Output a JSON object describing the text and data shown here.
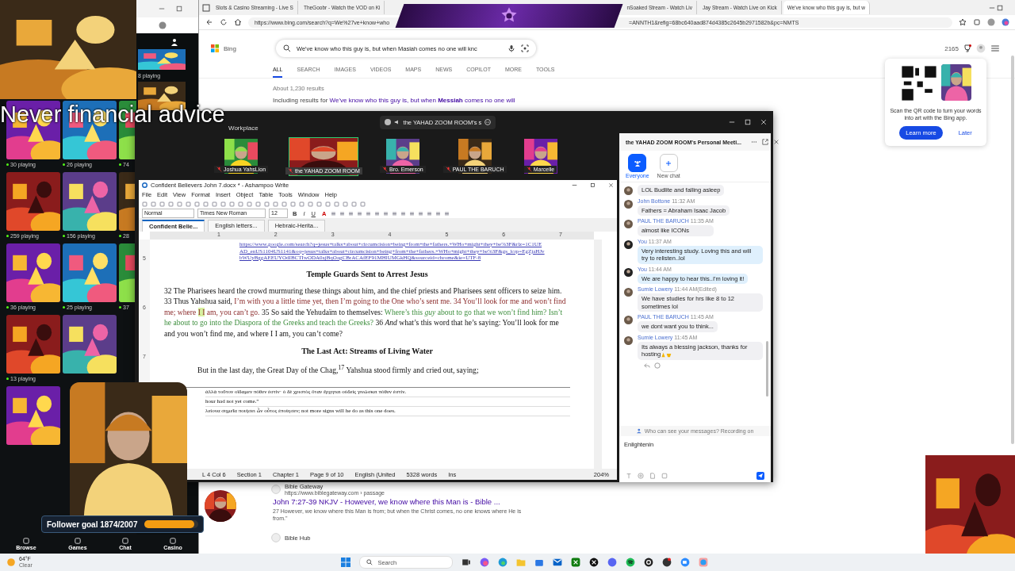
{
  "browser": {
    "tabs": [
      {
        "label": "Slots & Casino Streaming - Live S",
        "selected": false
      },
      {
        "label": "TheGoobr - Watch the VOD on Ki",
        "selected": false
      },
      {
        "label": "nSoaked Stream - Watch Liv",
        "selected": false
      },
      {
        "label": "Jay Stream - Watch Live on Kick",
        "selected": false
      },
      {
        "label": "We've know who this guy is, but w",
        "selected": true
      }
    ],
    "address_start": "https://www.bing.com/search?q=We%27ve+know+who",
    "address_end": "=ANNTH1&refig=68bc640aad874d4385c2645b2971582b&pc=NMTS"
  },
  "bing": {
    "logo_text": "Bing",
    "search_value": "We've know who this guy is, but when Masiah comes no one will knc",
    "points": "2165",
    "tabs": [
      {
        "label": "ALL",
        "selected": true
      },
      {
        "label": "SEARCH",
        "selected": false
      },
      {
        "label": "IMAGES",
        "selected": false
      },
      {
        "label": "VIDEOS",
        "selected": false
      },
      {
        "label": "MAPS",
        "selected": false
      },
      {
        "label": "NEWS",
        "selected": false
      },
      {
        "label": "COPILOT",
        "selected": false
      },
      {
        "label": "MORE",
        "selected": false
      },
      {
        "label": "TOOLS",
        "selected": false
      }
    ],
    "result_count": "About 1,230 results",
    "including_prefix": "Including results for",
    "including_link": "We've know who this guy is, but when **Messiah** comes no one will",
    "qr_card": {
      "text": "Scan the QR code to turn your words into art with the Bing app.",
      "learn": "Learn more",
      "later": "Later"
    },
    "results": [
      {
        "site": "Bible Gateway",
        "url": "https://www.biblegateway.com › passage",
        "title": "John 7:27-39 NKJV - However, we know where this Man is - Bible ...",
        "snippet": "27 However, we know where this Man is from; but when the Christ comes, no one knows where He is from.\""
      },
      {
        "site": "Bible Hub"
      }
    ]
  },
  "kick_sidebar": {
    "playing": "8 playing"
  },
  "casino": {
    "rows": [
      {
        "tiles": [
          {
            "kind": "game",
            "count": "30 playing"
          },
          {
            "kind": "game",
            "count": "26 playing"
          },
          {
            "kind": "game",
            "count": "74"
          }
        ]
      },
      {
        "tiles": [
          {
            "kind": "game",
            "count": "259 playing"
          },
          {
            "kind": "game",
            "count": "156 playing"
          },
          {
            "kind": "game",
            "count": "28"
          }
        ]
      },
      {
        "tiles": [
          {
            "kind": "game",
            "count": "36 playing"
          },
          {
            "kind": "game",
            "count": "25 playing"
          },
          {
            "kind": "game",
            "count": "37"
          }
        ]
      },
      {
        "tiles": [
          {
            "kind": "game",
            "count": "13 playing"
          },
          {
            "kind": "game"
          }
        ]
      },
      {
        "tiles": [
          {
            "kind": "game"
          }
        ]
      }
    ],
    "nav": [
      "Browse",
      "Games",
      "Chat",
      "Casino"
    ]
  },
  "overlay_text": "Never financial advice",
  "follower_goal": {
    "label": "Follower goal 1874/2007",
    "level": 0.93
  },
  "zoom": {
    "workplace": "Workplace",
    "speaker": "the YAHAD ZOOM ROOM's s",
    "participants": [
      {
        "name": "Joshua YahsLion",
        "selected": false
      },
      {
        "name": "the YAHAD ZOOM ROOM",
        "selected": true
      },
      {
        "name": "Bro. Emerson",
        "selected": false
      },
      {
        "name": "PAUL THE BARUCH",
        "selected": false
      },
      {
        "name": "Marcelle",
        "selected": false
      }
    ],
    "chat": {
      "title": "the YAHAD ZOOM ROOM's Personal Meeti...",
      "tabs": [
        {
          "label": "Everyone",
          "selected": true
        },
        {
          "label": "New chat",
          "selected": false
        }
      ],
      "messages": [
        {
          "text": "LOL Budlite and falling asleep",
          "mine": false
        },
        {
          "sender": "John Bottone",
          "time": "11:32 AM",
          "text": "Fathers = Abraham Isaac Jacob",
          "mine": false
        },
        {
          "sender": "PAUL THE BARUCH",
          "time": "11:35 AM",
          "text": "almost like ICONs",
          "mine": false
        },
        {
          "sender": "You",
          "time": "11:37 AM",
          "text": "Very interesting study. Loving this and will try to relisten..lol",
          "mine": true
        },
        {
          "sender": "You",
          "time": "11:44 AM",
          "text": "We are happy to hear this..I'm loving it!",
          "mine": true
        },
        {
          "sender": "Sumie Lowery",
          "time": "11:44 AM",
          "edited": "(Edited)",
          "text": "We have studies for hrs like 8 to 12 sometimes lol",
          "mine": false
        },
        {
          "sender": "PAUL THE BARUCH",
          "time": "11:45 AM",
          "text": "we dont want you to think...",
          "mine": false
        },
        {
          "sender": "Sumie Lowery",
          "time": "11:45 AM",
          "text": "Its always a blessing jackson, thanks for hosting",
          "emoji": true,
          "mine": false
        }
      ],
      "notice": "Who can see your messages? Recording on",
      "input_value": "Enlightenin"
    }
  },
  "writer": {
    "title": "Confident Believers John 7.docx * - Ashampoo Write",
    "menu": [
      "File",
      "Edit",
      "View",
      "Format",
      "Insert",
      "Object",
      "Table",
      "Tools",
      "Window",
      "Help"
    ],
    "style": "Normal",
    "font": "Times New Roman",
    "size": "12",
    "format_buttons": [
      "B",
      "I",
      "U",
      "A"
    ],
    "doc_tabs": [
      {
        "label": "Confident Belie...",
        "selected": true
      },
      {
        "label": "English letters...",
        "selected": false
      },
      {
        "label": "Hebraic-Herita...",
        "selected": false
      }
    ],
    "ruler": [
      "1",
      "2",
      "3",
      "4",
      "5",
      "6",
      "7"
    ],
    "side_ruler": [
      "5",
      "6",
      "7"
    ],
    "link": "https://www.google.com/search?q=jesus+talks+about+circumcision+being+from+the+fathers.+WHo+might+they+be%3F&rlz=1C1UEAD_enUS1104US1141&oq=jesus+talks+about+circumcision+being+from+the+fathers.+WHo+might+they+be%3F&gs_lcrp=EgZjaHJvbWUyBggAEEUYOdIBCTIwODA0ajBqOagCBrACAfEF91MHlUMGkHQ&sourceid=chrome&ie=UTF-8",
    "heading1": "Temple Guards Sent to Arrest Jesus",
    "paragraph": [
      {
        "kind": "plain",
        "text": "32 The Pharisees heard the crowd murmuring these things about him, and the chief priests and Pharisees sent officers to seize him. 33 Thus Yahshua said, "
      },
      {
        "kind": "speech",
        "text": "I’m with you a little time yet, then I’m going to the One who’s sent me. 34 You’ll look for me and won’t find me; where "
      },
      {
        "kind": "highlight",
        "text": "I I"
      },
      {
        "kind": "speech",
        "text": " am, you can’t go."
      },
      {
        "kind": "plain",
        "text": " 35 So said the Yehudaïm to themselves: "
      },
      {
        "kind": "question",
        "text": "Where’s this "
      },
      {
        "kind": "stress",
        "text": "guy"
      },
      {
        "kind": "question",
        "text": " about to go that we won’t find him? Isn’t he about to go into the Diaspora of the Greeks and teach the Greeks?"
      },
      {
        "kind": "plain",
        "text": " 36 "
      },
      {
        "kind": "emphasis",
        "text": "And"
      },
      {
        "kind": "plain",
        "text": " what’s this word that he’s saying: You’ll look for me and you won’t find me, and where I I am, you can’t come?"
      }
    ],
    "heading2": "The Last Act: Streams of Living Water",
    "paragraph2": "But in the last day, the Great Day of the Chag,$^{17}$ Yahshua stood firmly and cried out, saying;",
    "footnotes": [
      "ἀλλὰ τοῦτον οἴδαμεν πόθεν ἐστίν· ὁ δὲ χριστὸς ὅταν ἔρχηται οὐδεὶς γινώσκει πόθεν ἐστίν.",
      "hour had not yet come.”",
      "λείονα σημεῖα ποιήσει ὧν οὗτος ἐποίησεν; not more signs will he do as this one does."
    ],
    "status": [
      "L 4 Col 6",
      "Section 1",
      "Chapter 1",
      "Page 9 of 10",
      "English (United",
      "5328 words",
      "Ins"
    ],
    "zoom_level": "204%"
  },
  "taskbar": {
    "temperature": "64°F",
    "condition": "Clear",
    "search": "Search"
  }
}
